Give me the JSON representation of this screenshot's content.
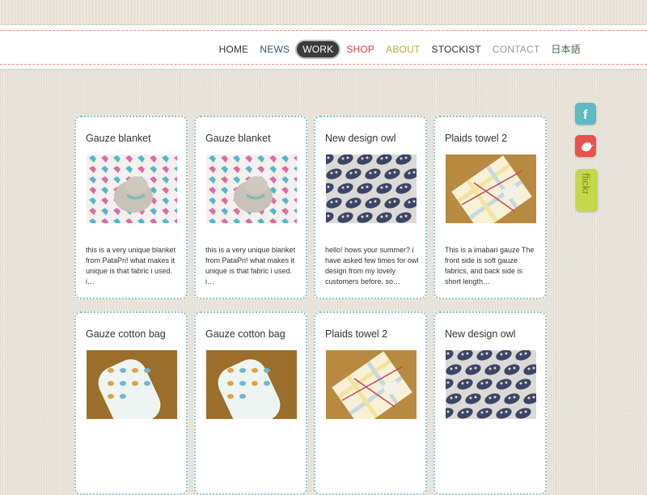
{
  "nav": {
    "items": [
      {
        "label": "HOME",
        "color": "#333333",
        "active": false
      },
      {
        "label": "NEWS",
        "color": "#2e5a7a",
        "active": false
      },
      {
        "label": "WORK",
        "color": "#ffffff",
        "active": true
      },
      {
        "label": "SHOP",
        "color": "#d0413a",
        "active": false
      },
      {
        "label": "ABOUT",
        "color": "#b8ad2c",
        "active": false
      },
      {
        "label": "STOCKIST",
        "color": "#333333",
        "active": false
      },
      {
        "label": "CONTACT",
        "color": "#9a9a9a",
        "active": false
      },
      {
        "label": "日本語",
        "color": "#3f6a3c",
        "active": false
      }
    ]
  },
  "cards": [
    {
      "title": "Gauze blanket",
      "text": "this is a very unique blanket from PataPri! what makes it unique is that fabric i used. i…",
      "image": "gauze-blanket-photo"
    },
    {
      "title": "Gauze blanket",
      "text": "this is a very unique blanket from PataPri! what makes it unique is that fabric i used. i…",
      "image": "gauze-blanket-photo"
    },
    {
      "title": "New design owl",
      "text": "hello! hows your summer? i have asked few times for owl design from my lovely customers before. so…",
      "image": "owl-fabric-photo"
    },
    {
      "title": "Plaids towel 2",
      "text": "This is a imabari gauze The front side is soft gauze fabrics, and back side is short length…",
      "image": "plaid-towel-photo"
    },
    {
      "title": "Gauze cotton bag",
      "text": "",
      "image": "cotton-bag-photo"
    },
    {
      "title": "Gauze cotton bag",
      "text": "",
      "image": "cotton-bag-photo"
    },
    {
      "title": "Plaids towel 2",
      "text": "",
      "image": "plaid-towel-photo"
    },
    {
      "title": "New design owl",
      "text": "",
      "image": "owl-fabric-photo"
    }
  ],
  "social": {
    "facebook": {
      "label": "f",
      "color": "#5bbcc4"
    },
    "twitter": {
      "label": "twitter-bird",
      "color": "#e9514a"
    },
    "flickr": {
      "label": "flickr",
      "color": "#c4d94a"
    }
  }
}
